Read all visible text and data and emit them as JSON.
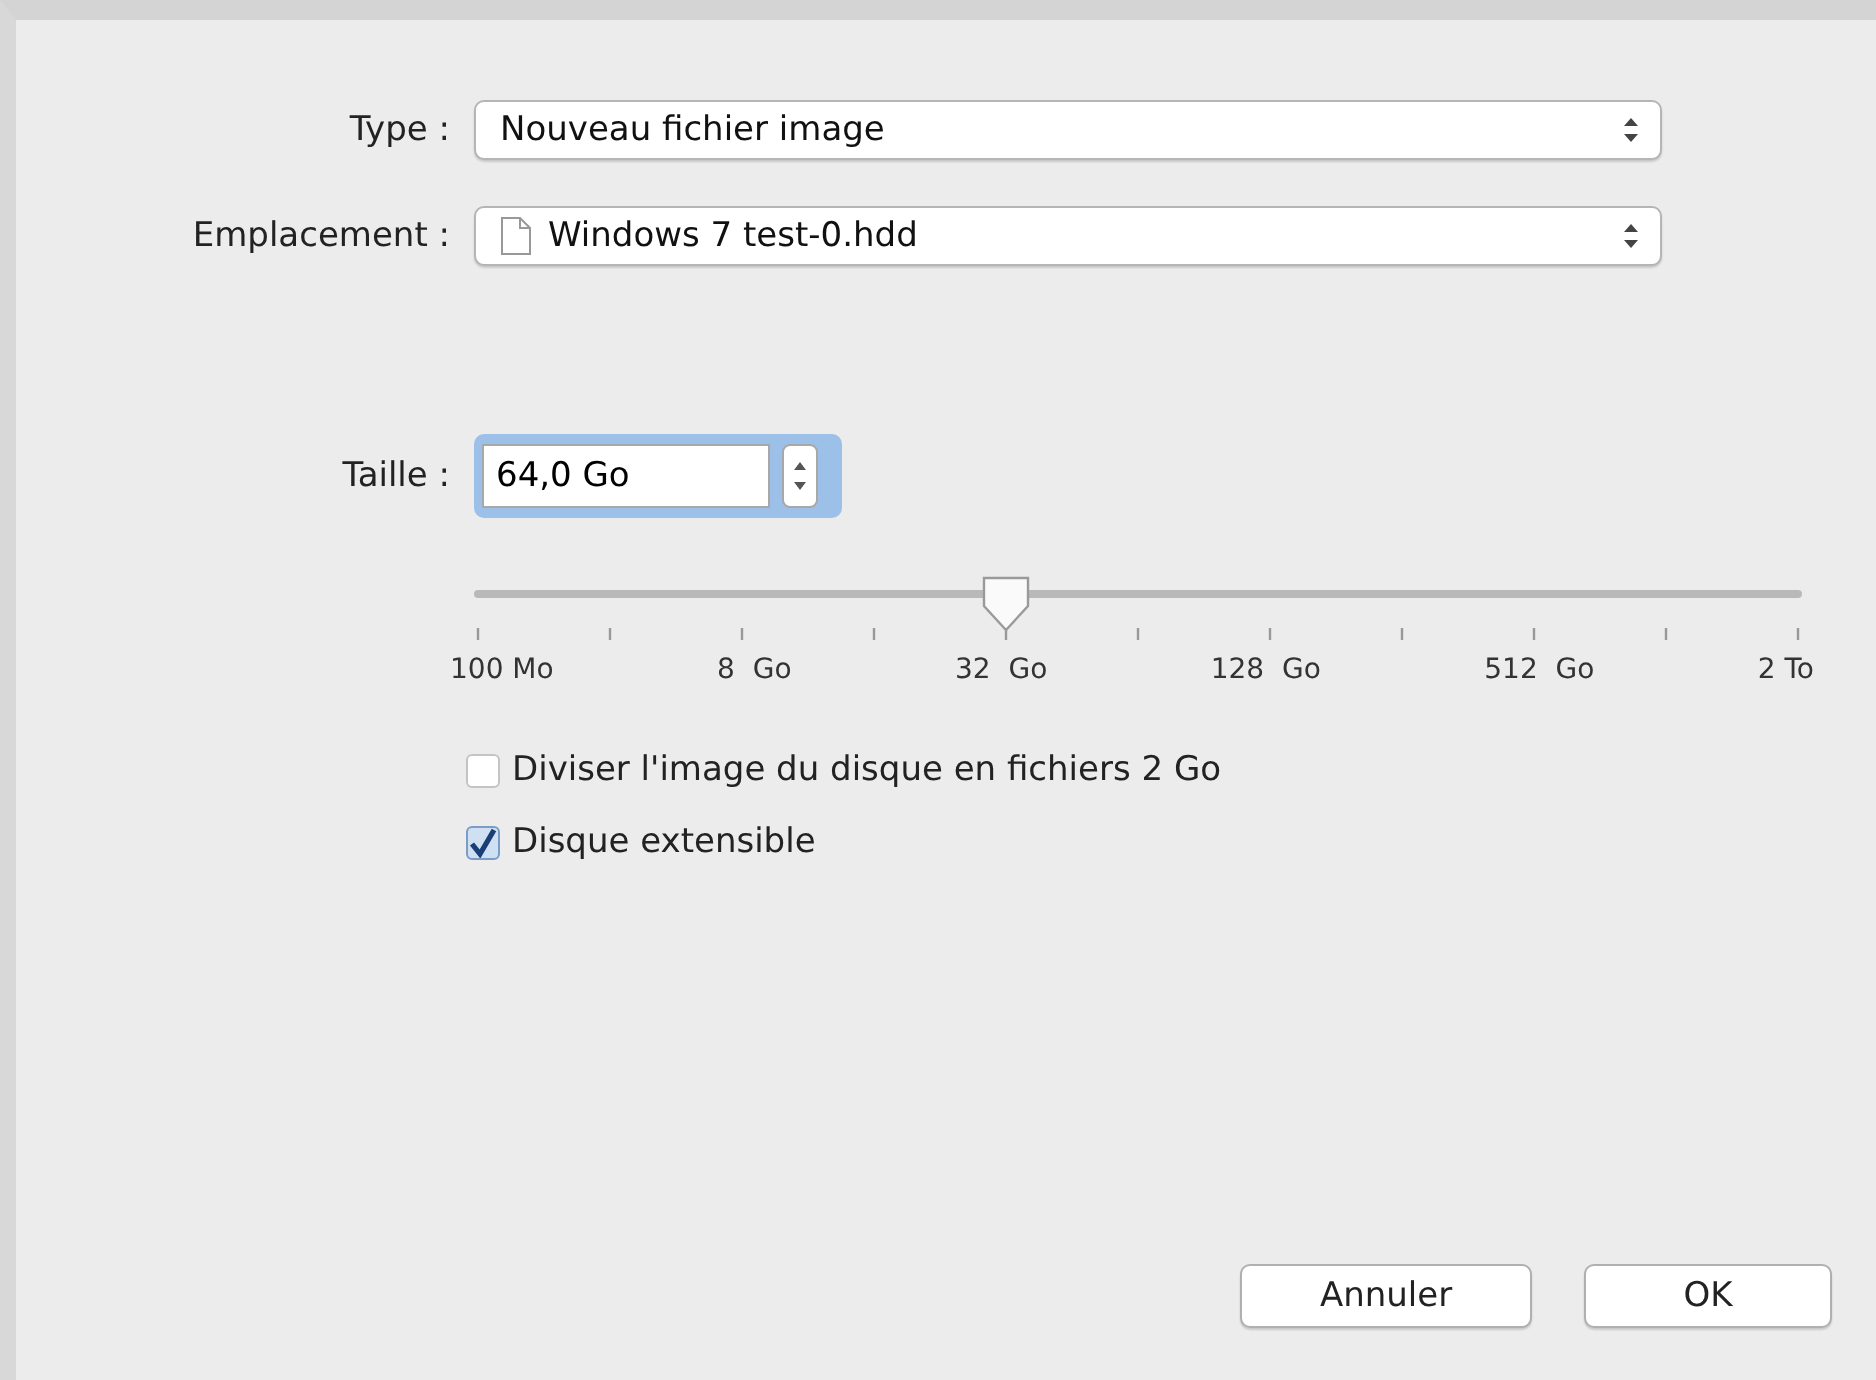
{
  "fields": [
    {
      "label": "Type :",
      "value": "Nouveau fichier image",
      "kind": "plain"
    },
    {
      "label": "Emplacement :",
      "value": "Windows 7 test-0.hdd",
      "kind": "file"
    }
  ],
  "size": {
    "label": "Taille :",
    "value": "64,0 Go",
    "focused": true
  },
  "slider": {
    "level": 0.4,
    "labels": [
      "100 Mo",
      "8  Go",
      "32  Go",
      "128  Go",
      "512  Go",
      "2 To"
    ]
  },
  "options": [
    {
      "label": "Diviser l'image du disque en fichiers 2 Go",
      "checked": false
    },
    {
      "label": "Disque extensible",
      "checked": true
    }
  ],
  "buttons": [
    "Annuler",
    "OK"
  ]
}
